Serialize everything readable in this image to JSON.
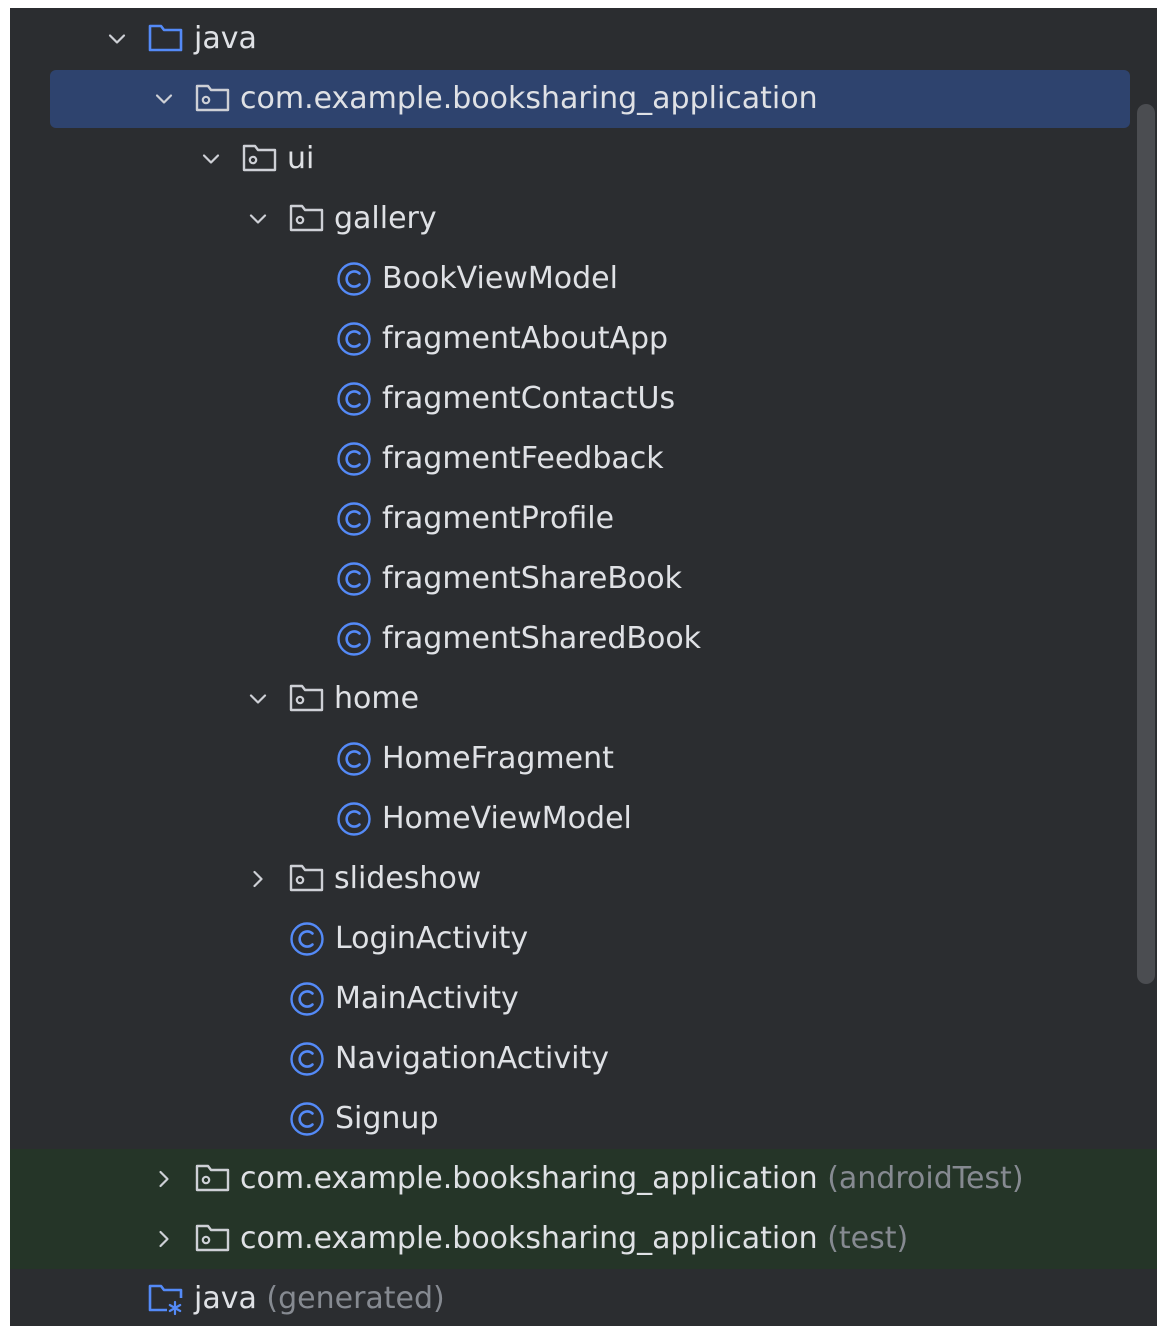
{
  "project_tree": {
    "items": [
      {
        "label": "java",
        "suffix": "",
        "icon": "source-root-folder-icon",
        "expand": "expanded",
        "depth": 0
      },
      {
        "label": "com.example.booksharing_application",
        "suffix": "",
        "icon": "package-folder-icon",
        "expand": "expanded",
        "depth": 1,
        "selected": true
      },
      {
        "label": "ui",
        "suffix": "",
        "icon": "package-folder-icon",
        "expand": "expanded",
        "depth": 2
      },
      {
        "label": "gallery",
        "suffix": "",
        "icon": "package-folder-icon",
        "expand": "expanded",
        "depth": 3
      },
      {
        "label": "BookViewModel",
        "suffix": "",
        "icon": "java-class-icon",
        "expand": "none",
        "depth": 4
      },
      {
        "label": "fragmentAboutApp",
        "suffix": "",
        "icon": "java-class-icon",
        "expand": "none",
        "depth": 4
      },
      {
        "label": "fragmentContactUs",
        "suffix": "",
        "icon": "java-class-icon",
        "expand": "none",
        "depth": 4
      },
      {
        "label": "fragmentFeedback",
        "suffix": "",
        "icon": "java-class-icon",
        "expand": "none",
        "depth": 4
      },
      {
        "label": "fragmentProfile",
        "suffix": "",
        "icon": "java-class-icon",
        "expand": "none",
        "depth": 4
      },
      {
        "label": "fragmentShareBook",
        "suffix": "",
        "icon": "java-class-icon",
        "expand": "none",
        "depth": 4
      },
      {
        "label": "fragmentSharedBook",
        "suffix": "",
        "icon": "java-class-icon",
        "expand": "none",
        "depth": 4
      },
      {
        "label": "home",
        "suffix": "",
        "icon": "package-folder-icon",
        "expand": "expanded",
        "depth": 3
      },
      {
        "label": "HomeFragment",
        "suffix": "",
        "icon": "java-class-icon",
        "expand": "none",
        "depth": 4
      },
      {
        "label": "HomeViewModel",
        "suffix": "",
        "icon": "java-class-icon",
        "expand": "none",
        "depth": 4
      },
      {
        "label": "slideshow",
        "suffix": "",
        "icon": "package-folder-icon",
        "expand": "collapsed",
        "depth": 3
      },
      {
        "label": "LoginActivity",
        "suffix": "",
        "icon": "java-class-icon",
        "expand": "none",
        "depth": 3
      },
      {
        "label": "MainActivity",
        "suffix": "",
        "icon": "java-class-icon",
        "expand": "none",
        "depth": 3
      },
      {
        "label": "NavigationActivity",
        "suffix": "",
        "icon": "java-class-icon",
        "expand": "none",
        "depth": 3
      },
      {
        "label": "Signup",
        "suffix": "",
        "icon": "java-class-icon",
        "expand": "none",
        "depth": 3
      },
      {
        "label": "com.example.booksharing_application",
        "suffix": "(androidTest)",
        "icon": "package-folder-icon",
        "expand": "collapsed",
        "depth": 1,
        "test": true
      },
      {
        "label": "com.example.booksharing_application",
        "suffix": "(test)",
        "icon": "package-folder-icon",
        "expand": "collapsed",
        "depth": 1,
        "test": true
      },
      {
        "label": "java",
        "suffix": "(generated)",
        "icon": "generated-source-folder-icon",
        "expand": "none",
        "depth": 0
      }
    ]
  },
  "colors": {
    "background": "#2b2d30",
    "selection": "#2e436e",
    "test_highlight": "#253528",
    "text": "#dfe1e5",
    "muted_text": "#868a91",
    "class_icon": "#548af7",
    "source_folder_icon": "#548af7",
    "package_icon": "#ced0d6",
    "chevron": "#ced0d6"
  }
}
